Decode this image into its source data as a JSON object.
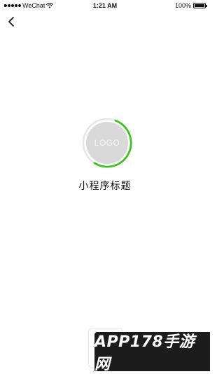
{
  "status_bar": {
    "carrier": "WeChat",
    "time": "1:21 AM",
    "battery_text": "100%",
    "battery_level": 1.0
  },
  "logo": {
    "text": "LOGO",
    "progress_color": "#3cc51f",
    "track_color": "#e6e6e6"
  },
  "app": {
    "title": "小程序标题"
  },
  "watermark": {
    "text": "APP178手游网"
  }
}
